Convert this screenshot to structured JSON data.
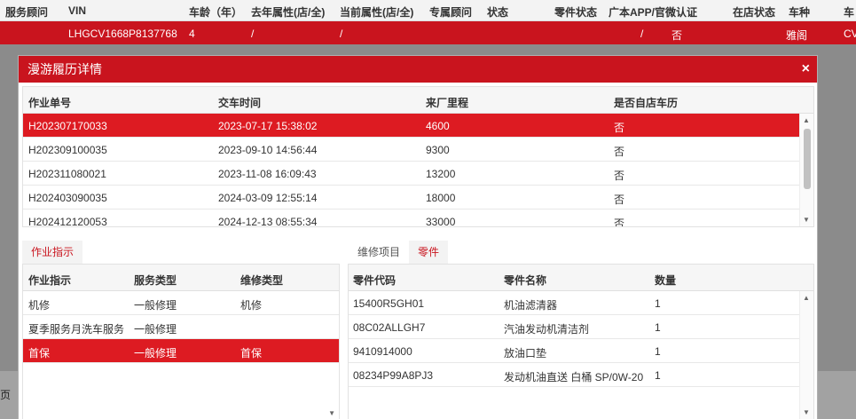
{
  "background": {
    "headers": [
      "服务顾问",
      "VIN",
      "车龄（年）",
      "去年属性(店/全)",
      "当前属性(店/全)",
      "专属顾问",
      "状态",
      "零件状态",
      "广本APP/官微认证",
      "在店状态",
      "车种",
      "车"
    ],
    "row": [
      "LHGCV1668P8137768",
      "4",
      "/",
      "/",
      "/",
      "否",
      "雅阁",
      "CV"
    ],
    "footer_text": "页"
  },
  "modal": {
    "title": "漫游履历详情",
    "close_label": "×",
    "history": {
      "columns": [
        "作业单号",
        "交车时间",
        "来厂里程",
        "是否自店车历"
      ],
      "rows": [
        [
          "H202307170033",
          "2023-07-17 15:38:02",
          "4600",
          "否"
        ],
        [
          "H202309100035",
          "2023-09-10 14:56:44",
          "9300",
          "否"
        ],
        [
          "H202311080021",
          "2023-11-08 16:09:43",
          "13200",
          "否"
        ],
        [
          "H202403090035",
          "2024-03-09 12:55:14",
          "18000",
          "否"
        ],
        [
          "H202412120053",
          "2024-12-13 08:55:34",
          "33000",
          "否"
        ]
      ],
      "selected_index": 0
    },
    "tabs_left": [
      "作业指示"
    ],
    "tabs_right": [
      "维修项目",
      "零件"
    ],
    "instructions": {
      "columns": [
        "作业指示",
        "服务类型",
        "维修类型"
      ],
      "rows": [
        [
          "机修",
          "一般修理",
          "机修"
        ],
        [
          "夏季服务月洗车服务",
          "一般修理",
          ""
        ],
        [
          "首保",
          "一般修理",
          "首保"
        ]
      ],
      "selected_index": 2
    },
    "parts": {
      "columns": [
        "零件代码",
        "零件名称",
        "数量"
      ],
      "rows": [
        [
          "15400R5GH01",
          "机油滤清器",
          "1"
        ],
        [
          "08C02ALLGH7",
          "汽油发动机清洁剂",
          "1"
        ],
        [
          "9410914000",
          "放油口垫",
          "1"
        ],
        [
          "08234P99A8PJ3",
          "发动机油直送 白桶 SP/0W-20",
          "1"
        ]
      ]
    },
    "colors": {
      "accent": "#dd1b22",
      "title_bar": "#c9141e"
    }
  }
}
